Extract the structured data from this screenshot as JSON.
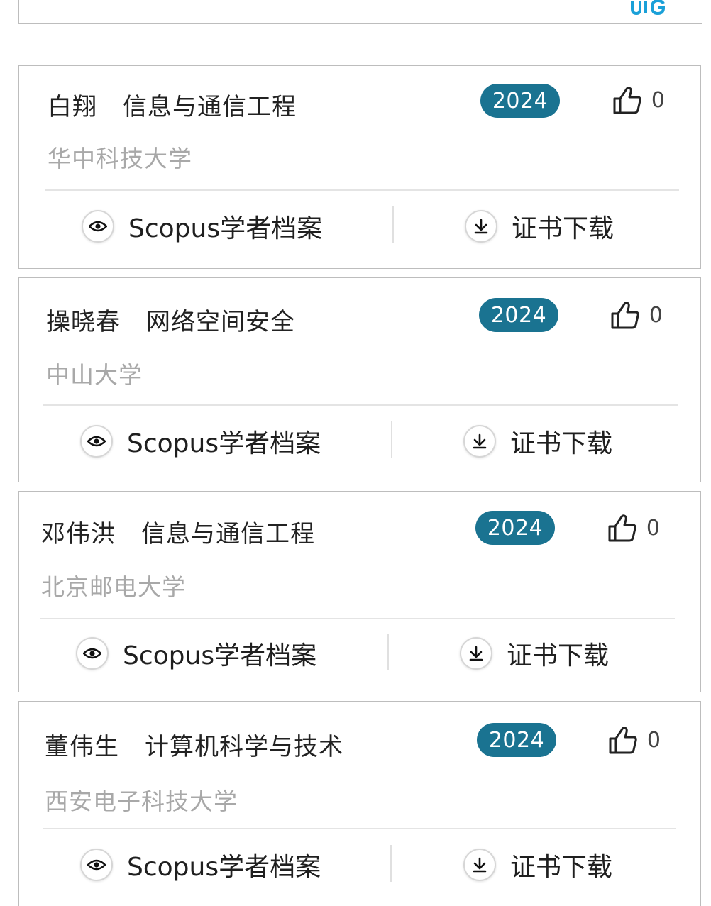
{
  "colors": {
    "badge_bg": "#1a7391",
    "school_text": "#a8a8a8",
    "logo": "#1aa0d8"
  },
  "logo": {
    "text": "JIG"
  },
  "cards": [
    {
      "name": "白翔",
      "major": "信息与通信工程",
      "year": "2024",
      "likes": "0",
      "school": "华中科技大学",
      "profile_label": "Scopus学者档案",
      "download_label": "证书下载"
    },
    {
      "name": "操晓春",
      "major": "网络空间安全",
      "year": "2024",
      "likes": "0",
      "school": "中山大学",
      "profile_label": "Scopus学者档案",
      "download_label": "证书下载"
    },
    {
      "name": "邓伟洪",
      "major": "信息与通信工程",
      "year": "2024",
      "likes": "0",
      "school": "北京邮电大学",
      "profile_label": "Scopus学者档案",
      "download_label": "证书下载"
    },
    {
      "name": "董伟生",
      "major": "计算机科学与技术",
      "year": "2024",
      "likes": "0",
      "school": "西安电子科技大学",
      "profile_label": "Scopus学者档案",
      "download_label": "证书下载"
    }
  ]
}
